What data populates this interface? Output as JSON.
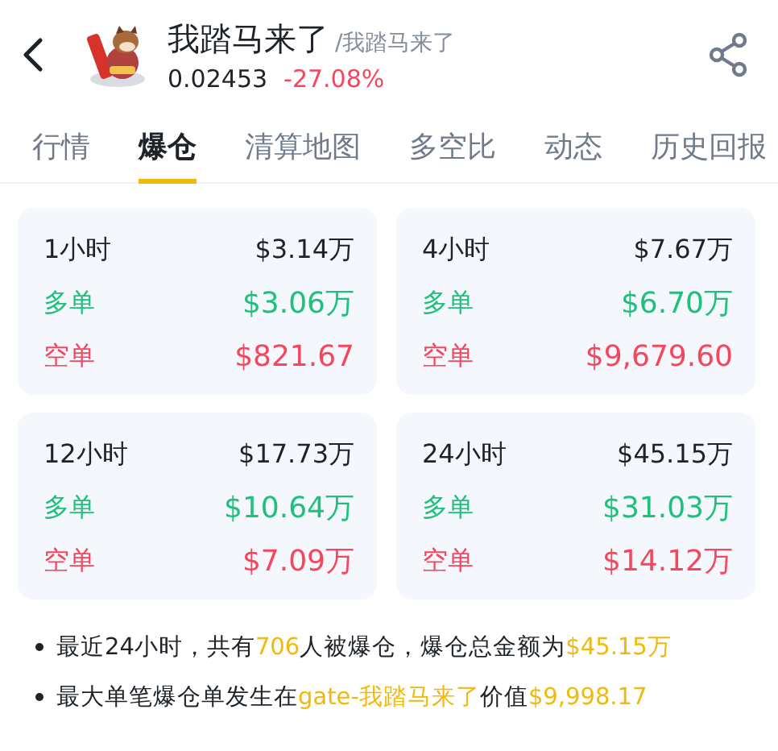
{
  "header": {
    "title": "我踏马来了",
    "subtitle": "/我踏马来了",
    "price": "0.02453",
    "change": "-27.08%"
  },
  "tabs": [
    {
      "label": "行情",
      "selected": false
    },
    {
      "label": "爆仓",
      "selected": true
    },
    {
      "label": "清算地图",
      "selected": false
    },
    {
      "label": "多空比",
      "selected": false
    },
    {
      "label": "动态",
      "selected": false
    },
    {
      "label": "历史回报",
      "selected": false
    }
  ],
  "cards": [
    {
      "period": "1小时",
      "total": "$3.14万",
      "long_label": "多单",
      "long_value": "$3.06万",
      "short_label": "空单",
      "short_value": "$821.67"
    },
    {
      "period": "4小时",
      "total": "$7.67万",
      "long_label": "多单",
      "long_value": "$6.70万",
      "short_label": "空单",
      "short_value": "$9,679.60"
    },
    {
      "period": "12小时",
      "total": "$17.73万",
      "long_label": "多单",
      "long_value": "$10.64万",
      "short_label": "空单",
      "short_value": "$7.09万"
    },
    {
      "period": "24小时",
      "total": "$45.15万",
      "long_label": "多单",
      "long_value": "$31.03万",
      "short_label": "空单",
      "short_value": "$14.12万"
    }
  ],
  "notes": [
    [
      {
        "text": "最近24小时，共有",
        "highlight": false
      },
      {
        "text": "706",
        "highlight": true
      },
      {
        "text": "人被爆仓，爆仓总金额为",
        "highlight": false
      },
      {
        "text": "$45.15万",
        "highlight": true
      }
    ],
    [
      {
        "text": "最大单笔爆仓单发生在",
        "highlight": false
      },
      {
        "text": "gate-我踏马来了",
        "highlight": true
      },
      {
        "text": "价值",
        "highlight": false
      },
      {
        "text": "$9,998.17",
        "highlight": true
      }
    ]
  ]
}
